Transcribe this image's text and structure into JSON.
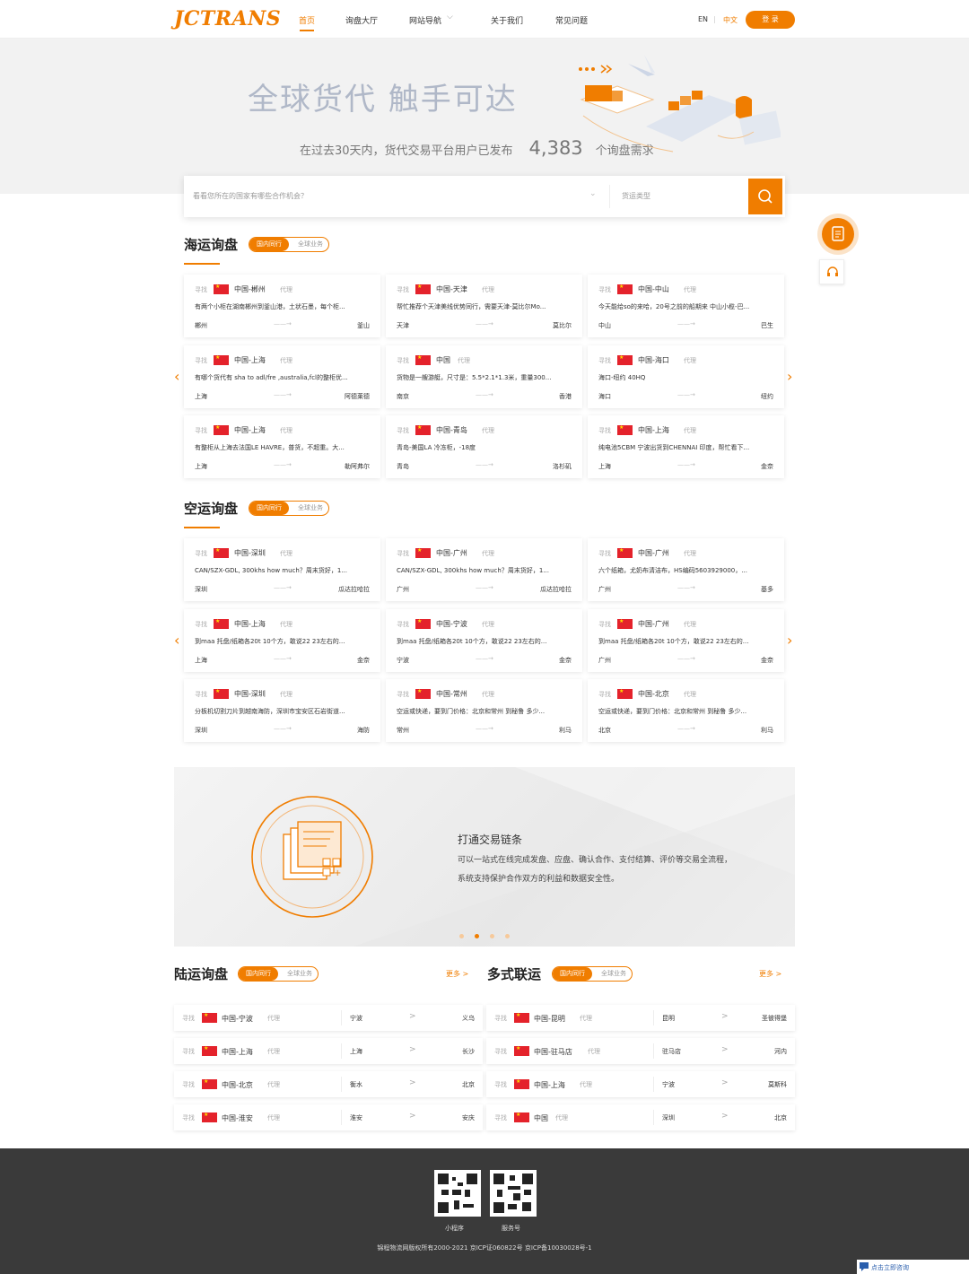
{
  "nav": {
    "logo": "JCTRANS",
    "items": [
      "首页",
      "询盘大厅",
      "网站导航",
      "关于我们",
      "常见问题"
    ],
    "nav_dropdown_caret": "⌵",
    "lang_en": "EN",
    "lang_zh": "中文",
    "login": "登 录"
  },
  "hero": {
    "title": "全球货代 触手可达",
    "stat_prefix": "在过去30天内，货代交易平台用户已发布",
    "stat_number": "4,383",
    "stat_suffix": "个询盘需求"
  },
  "search": {
    "placeholder": "看看您所在的国家有哪些合作机会？",
    "type_placeholder": "货运类型"
  },
  "toggle": {
    "on": "国内同行",
    "off": "全球业务"
  },
  "card_tag": "寻找",
  "card_arrow": "——→",
  "sea": {
    "title": "海运询盘",
    "cards": [
      {
        "route": "中国-郴州",
        "role": "代理",
        "desc": "有两个小柜在湖南郴州到釜山港，土状石墨，每个柜...",
        "from": "郴州",
        "to": "釜山"
      },
      {
        "route": "中国-天津",
        "role": "代理",
        "desc": "帮忙推荐个天津美线优势同行，需要天津-莫比尔Mo...",
        "from": "天津",
        "to": "莫比尔"
      },
      {
        "route": "中国-中山",
        "role": "代理",
        "desc": "今天能给so的来哈，20号之前的船期来 中山小榄-巴...",
        "from": "中山",
        "to": "巴生"
      },
      {
        "route": "中国-上海",
        "role": "代理",
        "desc": "有哪个货代有 sha to adl/fre ,australia,fcl的整柜优...",
        "from": "上海",
        "to": "阿德莱德"
      },
      {
        "route": "中国",
        "role": "代理",
        "desc": "货物是一艘游艇，尺寸是：5.5*2.1*1.3米，重量300...",
        "from": "南京",
        "to": "香港"
      },
      {
        "route": "中国-海口",
        "role": "代理",
        "desc": "海口-纽约 40HQ",
        "from": "海口",
        "to": "纽约"
      },
      {
        "route": "中国-上海",
        "role": "代理",
        "desc": "有整柜从上海去法国LE HAVRE，普货，不超重。大...",
        "from": "上海",
        "to": "勒阿弗尔"
      },
      {
        "route": "中国-青岛",
        "role": "代理",
        "desc": "青岛-美国LA 冷冻柜，-18度",
        "from": "青岛",
        "to": "洛杉矶"
      },
      {
        "route": "中国-上海",
        "role": "代理",
        "desc": "纯电池5CBM 宁波出货到CHENNAI 印度，帮忙看下...",
        "from": "上海",
        "to": "金奈"
      }
    ]
  },
  "air": {
    "title": "空运询盘",
    "cards": [
      {
        "route": "中国-深圳",
        "role": "代理",
        "desc": "CAN/SZX-GDL, 300khs how much？周末货好，1...",
        "from": "深圳",
        "to": "瓜达拉哈拉"
      },
      {
        "route": "中国-广州",
        "role": "代理",
        "desc": "CAN/SZX-GDL, 300khs how much？周末货好，1...",
        "from": "广州",
        "to": "瓜达拉哈拉"
      },
      {
        "route": "中国-广州",
        "role": "代理",
        "desc": "六个纸箱，尤奶布清洁布，HS编码5603929000，...",
        "from": "广州",
        "to": "基多"
      },
      {
        "route": "中国-上海",
        "role": "代理",
        "desc": "到maa 托盘/纸箱各20t 10个方，敢说22 23左右的...",
        "from": "上海",
        "to": "金奈"
      },
      {
        "route": "中国-宁波",
        "role": "代理",
        "desc": "到maa 托盘/纸箱各20t 10个方，敢说22 23左右的...",
        "from": "宁波",
        "to": "金奈"
      },
      {
        "route": "中国-广州",
        "role": "代理",
        "desc": "到maa 托盘/纸箱各20t 10个方，敢说22 23左右的...",
        "from": "广州",
        "to": "金奈"
      },
      {
        "route": "中国-深圳",
        "role": "代理",
        "desc": "分板机切割刀片到越南海防，深圳市宝安区石岩街道...",
        "from": "深圳",
        "to": "海防"
      },
      {
        "route": "中国-常州",
        "role": "代理",
        "desc": "空运或快递，要到门价格：北京和常州 到秘鲁 多少...",
        "from": "常州",
        "to": "利马"
      },
      {
        "route": "中国-北京",
        "role": "代理",
        "desc": "空运或快递，要到门价格：北京和常州 到秘鲁 多少...",
        "from": "北京",
        "to": "利马"
      }
    ]
  },
  "banner": {
    "title": "打通交易链条",
    "text": "可以一站式在线完成发盘、应盘、确认合作、支付结算、评价等交易全流程，系统支持保护合作双方的利益和数据安全性。"
  },
  "land": {
    "title": "陆运询盘",
    "more": "更多 >",
    "rows": [
      {
        "route": "中国-宁波",
        "role": "代理",
        "from": "宁波",
        "to": "义乌"
      },
      {
        "route": "中国-上海",
        "role": "代理",
        "from": "上海",
        "to": "长沙"
      },
      {
        "route": "中国-北京",
        "role": "代理",
        "from": "衡水",
        "to": "北京"
      },
      {
        "route": "中国-淮安",
        "role": "代理",
        "from": "淮安",
        "to": "安庆"
      }
    ]
  },
  "multi": {
    "title": "多式联运",
    "more": "更多 >",
    "rows": [
      {
        "route": "中国-昆明",
        "role": "代理",
        "from": "昆明",
        "to": "圣彼得堡"
      },
      {
        "route": "中国-驻马店",
        "role": "代理",
        "from": "驻马店",
        "to": "河内"
      },
      {
        "route": "中国-上海",
        "role": "代理",
        "from": "宁波",
        "to": "莫斯科"
      },
      {
        "route": "中国",
        "role": "代理",
        "from": "深圳",
        "to": "北京"
      }
    ]
  },
  "footer": {
    "qr1_label": "小程序",
    "qr2_label": "服务号",
    "copyright": "锦程物流网版权所有2000-2021 京ICP证060822号 京ICP备10030028号-1",
    "chat": "点击立即咨询"
  },
  "colors": {
    "accent": "#f07d00",
    "footer": "#3a3a3a"
  }
}
